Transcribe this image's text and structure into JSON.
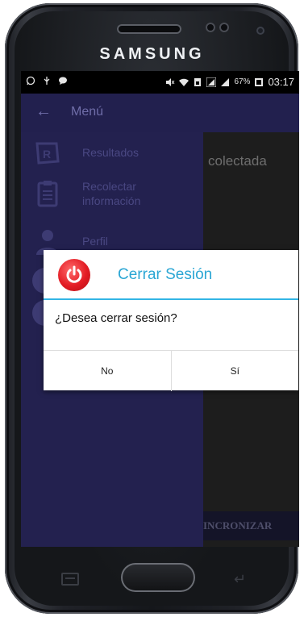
{
  "device": {
    "brand": "SAMSUNG"
  },
  "status_bar": {
    "battery": "67%",
    "time": "03:17"
  },
  "app_bar": {
    "back_icon": "arrow-left-icon",
    "title": "Menú"
  },
  "background_screen": {
    "text": "colectada",
    "button_label": "INCRONIZAR"
  },
  "drawer": {
    "items": [
      {
        "label": "Resultados",
        "icon": "results-icon"
      },
      {
        "label": "Recolectar información",
        "icon": "clipboard-icon"
      },
      {
        "label": "Perfil",
        "icon": "user-icon"
      }
    ]
  },
  "dialog": {
    "icon": "power-icon",
    "title": "Cerrar Sesión",
    "message": "¿Desea cerrar sesión?",
    "buttons": {
      "no": "No",
      "yes": "Sí"
    },
    "accent_color": "#33b5e5",
    "icon_color": "#e31c24"
  },
  "colors": {
    "app_bar": "#22204e",
    "drawer": "#23214f"
  }
}
